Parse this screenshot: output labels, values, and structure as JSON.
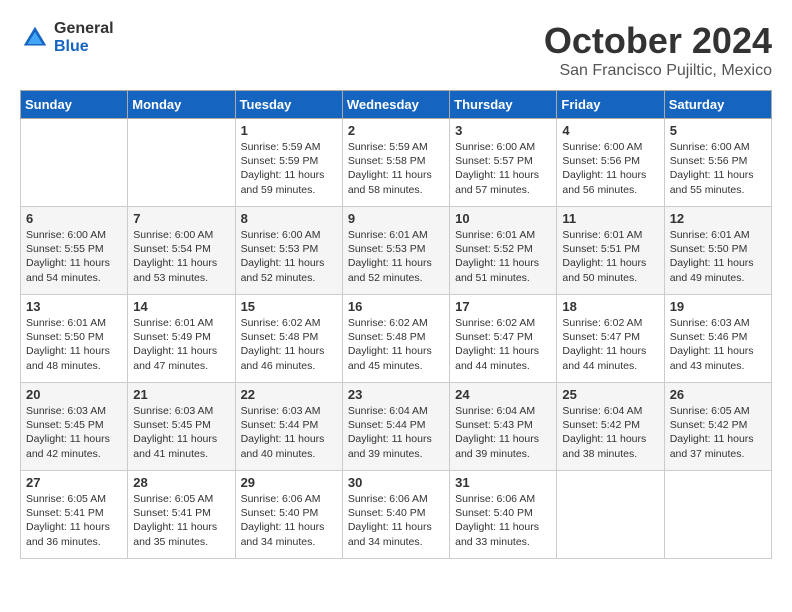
{
  "header": {
    "logo_general": "General",
    "logo_blue": "Blue",
    "month": "October 2024",
    "location": "San Francisco Pujiltic, Mexico"
  },
  "days_of_week": [
    "Sunday",
    "Monday",
    "Tuesday",
    "Wednesday",
    "Thursday",
    "Friday",
    "Saturday"
  ],
  "weeks": [
    [
      {
        "day": "",
        "content": ""
      },
      {
        "day": "",
        "content": ""
      },
      {
        "day": "1",
        "content": "Sunrise: 5:59 AM\nSunset: 5:59 PM\nDaylight: 11 hours and 59 minutes."
      },
      {
        "day": "2",
        "content": "Sunrise: 5:59 AM\nSunset: 5:58 PM\nDaylight: 11 hours and 58 minutes."
      },
      {
        "day": "3",
        "content": "Sunrise: 6:00 AM\nSunset: 5:57 PM\nDaylight: 11 hours and 57 minutes."
      },
      {
        "day": "4",
        "content": "Sunrise: 6:00 AM\nSunset: 5:56 PM\nDaylight: 11 hours and 56 minutes."
      },
      {
        "day": "5",
        "content": "Sunrise: 6:00 AM\nSunset: 5:56 PM\nDaylight: 11 hours and 55 minutes."
      }
    ],
    [
      {
        "day": "6",
        "content": "Sunrise: 6:00 AM\nSunset: 5:55 PM\nDaylight: 11 hours and 54 minutes."
      },
      {
        "day": "7",
        "content": "Sunrise: 6:00 AM\nSunset: 5:54 PM\nDaylight: 11 hours and 53 minutes."
      },
      {
        "day": "8",
        "content": "Sunrise: 6:00 AM\nSunset: 5:53 PM\nDaylight: 11 hours and 52 minutes."
      },
      {
        "day": "9",
        "content": "Sunrise: 6:01 AM\nSunset: 5:53 PM\nDaylight: 11 hours and 52 minutes."
      },
      {
        "day": "10",
        "content": "Sunrise: 6:01 AM\nSunset: 5:52 PM\nDaylight: 11 hours and 51 minutes."
      },
      {
        "day": "11",
        "content": "Sunrise: 6:01 AM\nSunset: 5:51 PM\nDaylight: 11 hours and 50 minutes."
      },
      {
        "day": "12",
        "content": "Sunrise: 6:01 AM\nSunset: 5:50 PM\nDaylight: 11 hours and 49 minutes."
      }
    ],
    [
      {
        "day": "13",
        "content": "Sunrise: 6:01 AM\nSunset: 5:50 PM\nDaylight: 11 hours and 48 minutes."
      },
      {
        "day": "14",
        "content": "Sunrise: 6:01 AM\nSunset: 5:49 PM\nDaylight: 11 hours and 47 minutes."
      },
      {
        "day": "15",
        "content": "Sunrise: 6:02 AM\nSunset: 5:48 PM\nDaylight: 11 hours and 46 minutes."
      },
      {
        "day": "16",
        "content": "Sunrise: 6:02 AM\nSunset: 5:48 PM\nDaylight: 11 hours and 45 minutes."
      },
      {
        "day": "17",
        "content": "Sunrise: 6:02 AM\nSunset: 5:47 PM\nDaylight: 11 hours and 44 minutes."
      },
      {
        "day": "18",
        "content": "Sunrise: 6:02 AM\nSunset: 5:47 PM\nDaylight: 11 hours and 44 minutes."
      },
      {
        "day": "19",
        "content": "Sunrise: 6:03 AM\nSunset: 5:46 PM\nDaylight: 11 hours and 43 minutes."
      }
    ],
    [
      {
        "day": "20",
        "content": "Sunrise: 6:03 AM\nSunset: 5:45 PM\nDaylight: 11 hours and 42 minutes."
      },
      {
        "day": "21",
        "content": "Sunrise: 6:03 AM\nSunset: 5:45 PM\nDaylight: 11 hours and 41 minutes."
      },
      {
        "day": "22",
        "content": "Sunrise: 6:03 AM\nSunset: 5:44 PM\nDaylight: 11 hours and 40 minutes."
      },
      {
        "day": "23",
        "content": "Sunrise: 6:04 AM\nSunset: 5:44 PM\nDaylight: 11 hours and 39 minutes."
      },
      {
        "day": "24",
        "content": "Sunrise: 6:04 AM\nSunset: 5:43 PM\nDaylight: 11 hours and 39 minutes."
      },
      {
        "day": "25",
        "content": "Sunrise: 6:04 AM\nSunset: 5:42 PM\nDaylight: 11 hours and 38 minutes."
      },
      {
        "day": "26",
        "content": "Sunrise: 6:05 AM\nSunset: 5:42 PM\nDaylight: 11 hours and 37 minutes."
      }
    ],
    [
      {
        "day": "27",
        "content": "Sunrise: 6:05 AM\nSunset: 5:41 PM\nDaylight: 11 hours and 36 minutes."
      },
      {
        "day": "28",
        "content": "Sunrise: 6:05 AM\nSunset: 5:41 PM\nDaylight: 11 hours and 35 minutes."
      },
      {
        "day": "29",
        "content": "Sunrise: 6:06 AM\nSunset: 5:40 PM\nDaylight: 11 hours and 34 minutes."
      },
      {
        "day": "30",
        "content": "Sunrise: 6:06 AM\nSunset: 5:40 PM\nDaylight: 11 hours and 34 minutes."
      },
      {
        "day": "31",
        "content": "Sunrise: 6:06 AM\nSunset: 5:40 PM\nDaylight: 11 hours and 33 minutes."
      },
      {
        "day": "",
        "content": ""
      },
      {
        "day": "",
        "content": ""
      }
    ]
  ]
}
